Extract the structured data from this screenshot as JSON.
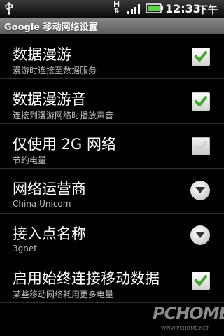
{
  "status_bar": {
    "network_type": "H",
    "time": "12:33",
    "ampm": "下午",
    "icons": [
      "usb-icon",
      "data-arrows-icon",
      "signal-icon",
      "battery-icon"
    ],
    "battery_color": "#5fd24b"
  },
  "title_bar": {
    "title": "Google 移动网络设置"
  },
  "settings": [
    {
      "title": "数据漫游",
      "summary": "漫游时连接至数据服务",
      "control": "checkbox",
      "checked": true,
      "enabled": true
    },
    {
      "title": "数据漫游音",
      "summary": "连接到漫游网络时播放声音",
      "control": "checkbox",
      "checked": true,
      "enabled": true
    },
    {
      "title": "仅使用 2G 网络",
      "summary": "节约电量",
      "control": "checkbox",
      "checked": true,
      "enabled": false
    },
    {
      "title": "网络运营商",
      "summary": "China Unicom",
      "control": "dropdown"
    },
    {
      "title": "接入点名称",
      "summary": "3gnet",
      "control": "dropdown"
    },
    {
      "title": "启用始终连接移动数据",
      "summary": "某些移动网络耗用更多电量",
      "control": "checkbox",
      "checked": true,
      "enabled": true
    }
  ],
  "watermark": {
    "text": "PCHOME",
    "sub": "WWW.PCHOME.NET"
  },
  "colors": {
    "check_green": "#3caa2a",
    "check_disabled": "#cfcfcf",
    "divider": "#2e2e2e"
  }
}
